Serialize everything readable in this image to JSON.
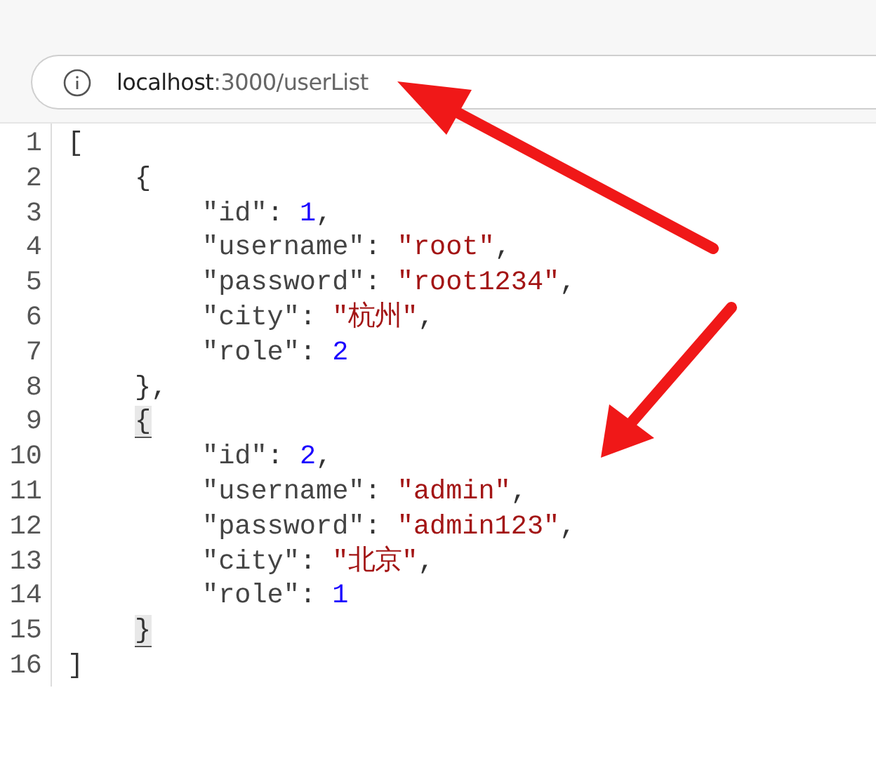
{
  "address_bar": {
    "host": "localhost",
    "path": ":3000/userList"
  },
  "lines": [
    {
      "number": "1",
      "tokens": [
        {
          "text": "[",
          "kind": "punct"
        }
      ],
      "children": [
        {
          "number": "2",
          "tokens": [
            {
              "text": "{",
              "kind": "punct"
            }
          ],
          "children": [
            {
              "number": "3",
              "tokens": [
                {
                  "text": "\"id\"",
                  "kind": "key"
                },
                {
                  "text": ": ",
                  "kind": "punct"
                },
                {
                  "text": "1",
                  "kind": "number"
                },
                {
                  "text": ",",
                  "kind": "punct"
                }
              ]
            },
            {
              "number": "4",
              "tokens": [
                {
                  "text": "\"username\"",
                  "kind": "key"
                },
                {
                  "text": ": ",
                  "kind": "punct"
                },
                {
                  "text": "\"root\"",
                  "kind": "string"
                },
                {
                  "text": ",",
                  "kind": "punct"
                }
              ]
            },
            {
              "number": "5",
              "tokens": [
                {
                  "text": "\"password\"",
                  "kind": "key"
                },
                {
                  "text": ": ",
                  "kind": "punct"
                },
                {
                  "text": "\"root1234\"",
                  "kind": "string"
                },
                {
                  "text": ",",
                  "kind": "punct"
                }
              ]
            },
            {
              "number": "6",
              "tokens": [
                {
                  "text": "\"city\"",
                  "kind": "key"
                },
                {
                  "text": ": ",
                  "kind": "punct"
                },
                {
                  "text": "\"杭州\"",
                  "kind": "string"
                },
                {
                  "text": ",",
                  "kind": "punct"
                }
              ]
            },
            {
              "number": "7",
              "tokens": [
                {
                  "text": "\"role\"",
                  "kind": "key"
                },
                {
                  "text": ": ",
                  "kind": "punct"
                },
                {
                  "text": "2",
                  "kind": "number"
                }
              ]
            }
          ]
        },
        {
          "number": "8",
          "tokens": [
            {
              "text": "},",
              "kind": "punct"
            }
          ]
        },
        {
          "number": "9",
          "tokens": [
            {
              "text": "{",
              "kind": "match"
            }
          ],
          "children": [
            {
              "number": "10",
              "tokens": [
                {
                  "text": "\"id\"",
                  "kind": "key"
                },
                {
                  "text": ": ",
                  "kind": "punct"
                },
                {
                  "text": "2",
                  "kind": "number"
                },
                {
                  "text": ",",
                  "kind": "punct"
                }
              ]
            },
            {
              "number": "11",
              "tokens": [
                {
                  "text": "\"username\"",
                  "kind": "key"
                },
                {
                  "text": ": ",
                  "kind": "punct"
                },
                {
                  "text": "\"admin\"",
                  "kind": "string"
                },
                {
                  "text": ",",
                  "kind": "punct"
                }
              ]
            },
            {
              "number": "12",
              "tokens": [
                {
                  "text": "\"password\"",
                  "kind": "key"
                },
                {
                  "text": ": ",
                  "kind": "punct"
                },
                {
                  "text": "\"admin123\"",
                  "kind": "string"
                },
                {
                  "text": ",",
                  "kind": "punct"
                }
              ]
            },
            {
              "number": "13",
              "tokens": [
                {
                  "text": "\"city\"",
                  "kind": "key"
                },
                {
                  "text": ": ",
                  "kind": "punct"
                },
                {
                  "text": "\"北京\"",
                  "kind": "string"
                },
                {
                  "text": ",",
                  "kind": "punct"
                }
              ]
            },
            {
              "number": "14",
              "tokens": [
                {
                  "text": "\"role\"",
                  "kind": "key"
                },
                {
                  "text": ": ",
                  "kind": "punct"
                },
                {
                  "text": "1",
                  "kind": "number"
                }
              ]
            }
          ]
        },
        {
          "number": "15",
          "tokens": [
            {
              "text": "}",
              "kind": "match"
            }
          ]
        }
      ]
    },
    {
      "number": "16",
      "tokens": [
        {
          "text": "]",
          "kind": "punct"
        }
      ]
    }
  ]
}
